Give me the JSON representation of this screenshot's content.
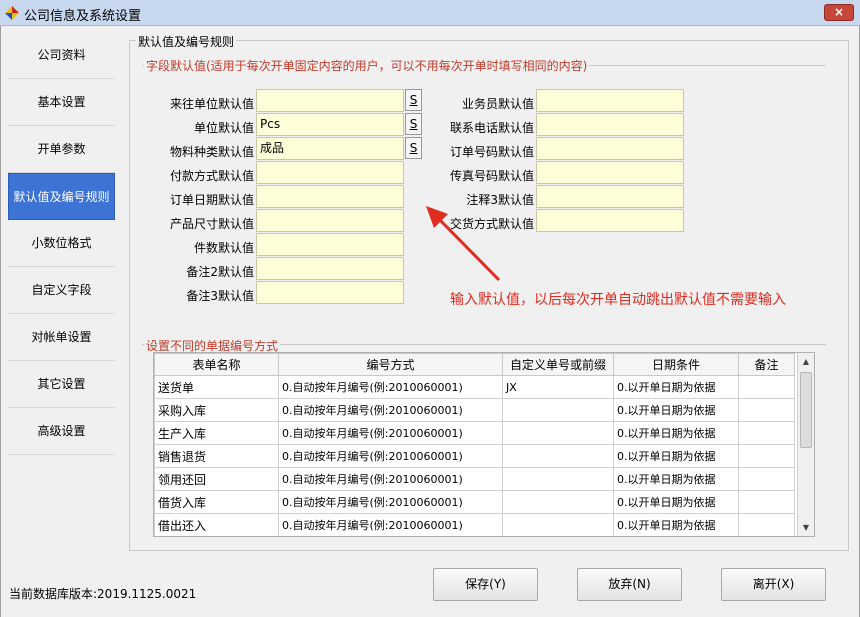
{
  "window": {
    "title": "公司信息及系统设置",
    "close_label": "×"
  },
  "nav": {
    "items": [
      {
        "label": "公司资料",
        "active": false
      },
      {
        "label": "基本设置",
        "active": false
      },
      {
        "label": "开单参数",
        "active": false
      },
      {
        "label": "默认值及编号规则",
        "active": true
      },
      {
        "label": "小数位格式",
        "active": false
      },
      {
        "label": "自定义字段",
        "active": false
      },
      {
        "label": "对帐单设置",
        "active": false
      },
      {
        "label": "其它设置",
        "active": false
      },
      {
        "label": "高级设置",
        "active": false
      }
    ]
  },
  "defaults_section": {
    "title": "默认值及编号规则",
    "subtitle": "字段默认值(适用于每次开单固定内容的用户，可以不用每次开单时填写相同的内容)",
    "s_button_label": "S",
    "left_fields": [
      {
        "label": "来往单位默认值",
        "value": ""
      },
      {
        "label": "单位默认值",
        "value": "Pcs"
      },
      {
        "label": "物料种类默认值",
        "value": "成品"
      },
      {
        "label": "付款方式默认值",
        "value": ""
      },
      {
        "label": "订单日期默认值",
        "value": ""
      },
      {
        "label": "产品尺寸默认值",
        "value": ""
      },
      {
        "label": "件数默认值",
        "value": ""
      },
      {
        "label": "备注2默认值",
        "value": ""
      },
      {
        "label": "备注3默认值",
        "value": ""
      }
    ],
    "right_fields": [
      {
        "label": "业务员默认值",
        "value": ""
      },
      {
        "label": "联系电话默认值",
        "value": ""
      },
      {
        "label": "订单号码默认值",
        "value": ""
      },
      {
        "label": "传真号码默认值",
        "value": ""
      },
      {
        "label": "注释3默认值",
        "value": ""
      },
      {
        "label": "交货方式默认值",
        "value": ""
      }
    ],
    "annotation": "输入默认值，以后每次开单自动跳出默认值不需要输入"
  },
  "numbering_section": {
    "title": "设置不同的单据编号方式",
    "columns": [
      "表单名称",
      "编号方式",
      "自定义单号或前缀",
      "日期条件",
      "备注"
    ],
    "rows": [
      [
        "送货单",
        "0.自动按年月编号(例:2010060001)",
        "JX",
        "0.以开单日期为依据",
        ""
      ],
      [
        "采购入库",
        "0.自动按年月编号(例:2010060001)",
        "",
        "0.以开单日期为依据",
        ""
      ],
      [
        "生产入库",
        "0.自动按年月编号(例:2010060001)",
        "",
        "0.以开单日期为依据",
        ""
      ],
      [
        "销售退货",
        "0.自动按年月编号(例:2010060001)",
        "",
        "0.以开单日期为依据",
        ""
      ],
      [
        "领用还回",
        "0.自动按年月编号(例:2010060001)",
        "",
        "0.以开单日期为依据",
        ""
      ],
      [
        "借货入库",
        "0.自动按年月编号(例:2010060001)",
        "",
        "0.以开单日期为依据",
        ""
      ],
      [
        "借出还入",
        "0.自动按年月编号(例:2010060001)",
        "",
        "0.以开单日期为依据",
        ""
      ]
    ]
  },
  "status": {
    "db_version": "当前数据库版本:2019.1125.0021"
  },
  "buttons": {
    "save": "保存(Y)",
    "cancel": "放弃(N)",
    "exit": "离开(X)"
  },
  "colors": {
    "active_nav": "#3d73d4",
    "input_bg": "#fefed8",
    "annotation": "#e02b20",
    "group_title": "#c03b2a"
  }
}
